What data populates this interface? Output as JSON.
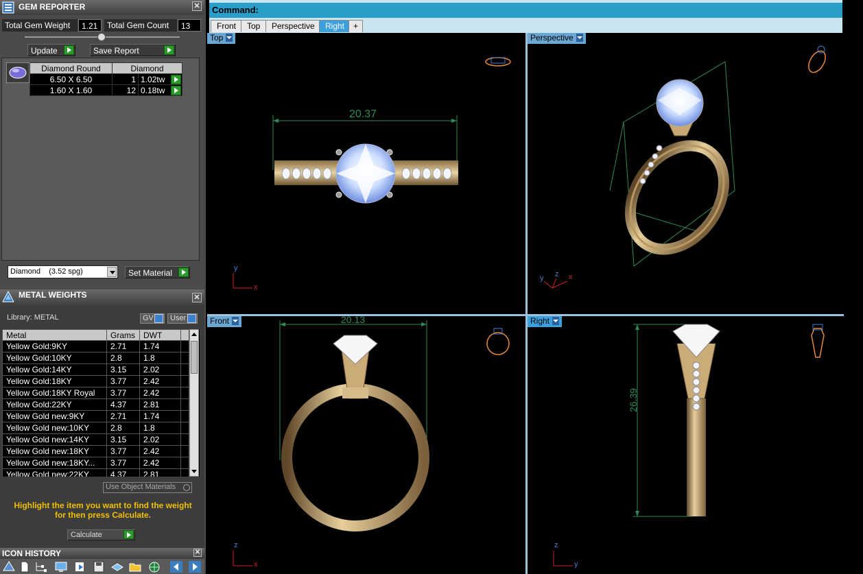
{
  "gem_reporter": {
    "title": "GEM REPORTER",
    "total_weight_label": "Total Gem Weight",
    "total_weight_value": "1.21",
    "total_count_label": "Total Gem Count",
    "total_count_value": "13",
    "update_label": "Update",
    "save_report_label": "Save Report",
    "table": {
      "headers": [
        "Diamond Round",
        "Diamond"
      ],
      "rows": [
        {
          "size": "6.50 X 6.50",
          "count": "1",
          "weight": "1.02tw"
        },
        {
          "size": "1.60 X 1.60",
          "count": "12",
          "weight": "0.18tw"
        }
      ]
    },
    "material_select": "Diamond    (3.52 spg)",
    "set_material_label": "Set Material"
  },
  "metal_weights": {
    "title": "METAL WEIGHTS",
    "library_label": "Library: METAL",
    "gv_label": "GV",
    "user_label": "User",
    "columns": [
      "Metal",
      "Grams",
      "DWT"
    ],
    "rows": [
      {
        "metal": "Yellow Gold:9KY",
        "grams": "2.71",
        "dwt": "1.74"
      },
      {
        "metal": "Yellow Gold:10KY",
        "grams": "2.8",
        "dwt": "1.8"
      },
      {
        "metal": "Yellow Gold:14KY",
        "grams": "3.15",
        "dwt": "2.02"
      },
      {
        "metal": "Yellow Gold:18KY",
        "grams": "3.77",
        "dwt": "2.42"
      },
      {
        "metal": "Yellow Gold:18KY Royal",
        "grams": "3.77",
        "dwt": "2.42"
      },
      {
        "metal": "Yellow Gold:22KY",
        "grams": "4.37",
        "dwt": "2.81"
      },
      {
        "metal": "Yellow Gold new:9KY",
        "grams": "2.71",
        "dwt": "1.74"
      },
      {
        "metal": "Yellow Gold new:10KY",
        "grams": "2.8",
        "dwt": "1.8"
      },
      {
        "metal": "Yellow Gold new:14KY",
        "grams": "3.15",
        "dwt": "2.02"
      },
      {
        "metal": "Yellow Gold new:18KY",
        "grams": "3.77",
        "dwt": "2.42"
      },
      {
        "metal": "Yellow Gold new:18KY...",
        "grams": "3.77",
        "dwt": "2.42"
      },
      {
        "metal": "Yellow Gold new:22KY",
        "grams": "4.37",
        "dwt": "2.81"
      }
    ],
    "use_object_materials_label": "Use Object Materials",
    "hint_line1": "Highlight the item you want to find the weight",
    "hint_line2": "for then press Calculate.",
    "calculate_label": "Calculate"
  },
  "icon_history": {
    "title": "ICON HISTORY",
    "icons": [
      "layers-icon",
      "new-document-icon",
      "hierarchy-icon",
      "monitor-icon",
      "import-icon",
      "save-icon",
      "export-icon",
      "open-folder-icon",
      "globe-icon",
      "arrow-left-icon",
      "arrow-right-icon"
    ]
  },
  "command": {
    "label": "Command:"
  },
  "view_tabs": [
    "Front",
    "Top",
    "Perspective",
    "Right",
    "+"
  ],
  "active_tab": "Right",
  "viewports": {
    "top": {
      "label": "Top",
      "dimension": "20.37",
      "axis_a": "y",
      "axis_b": "x"
    },
    "perspective": {
      "label": "Perspective",
      "axis_a": "y",
      "axis_b": "z",
      "axis_c": "x"
    },
    "front": {
      "label": "Front",
      "dimension": "20.13",
      "axis_a": "z",
      "axis_b": "x"
    },
    "right": {
      "label": "Right",
      "dimension": "26.39",
      "axis_a": "z",
      "axis_b": "y"
    }
  }
}
